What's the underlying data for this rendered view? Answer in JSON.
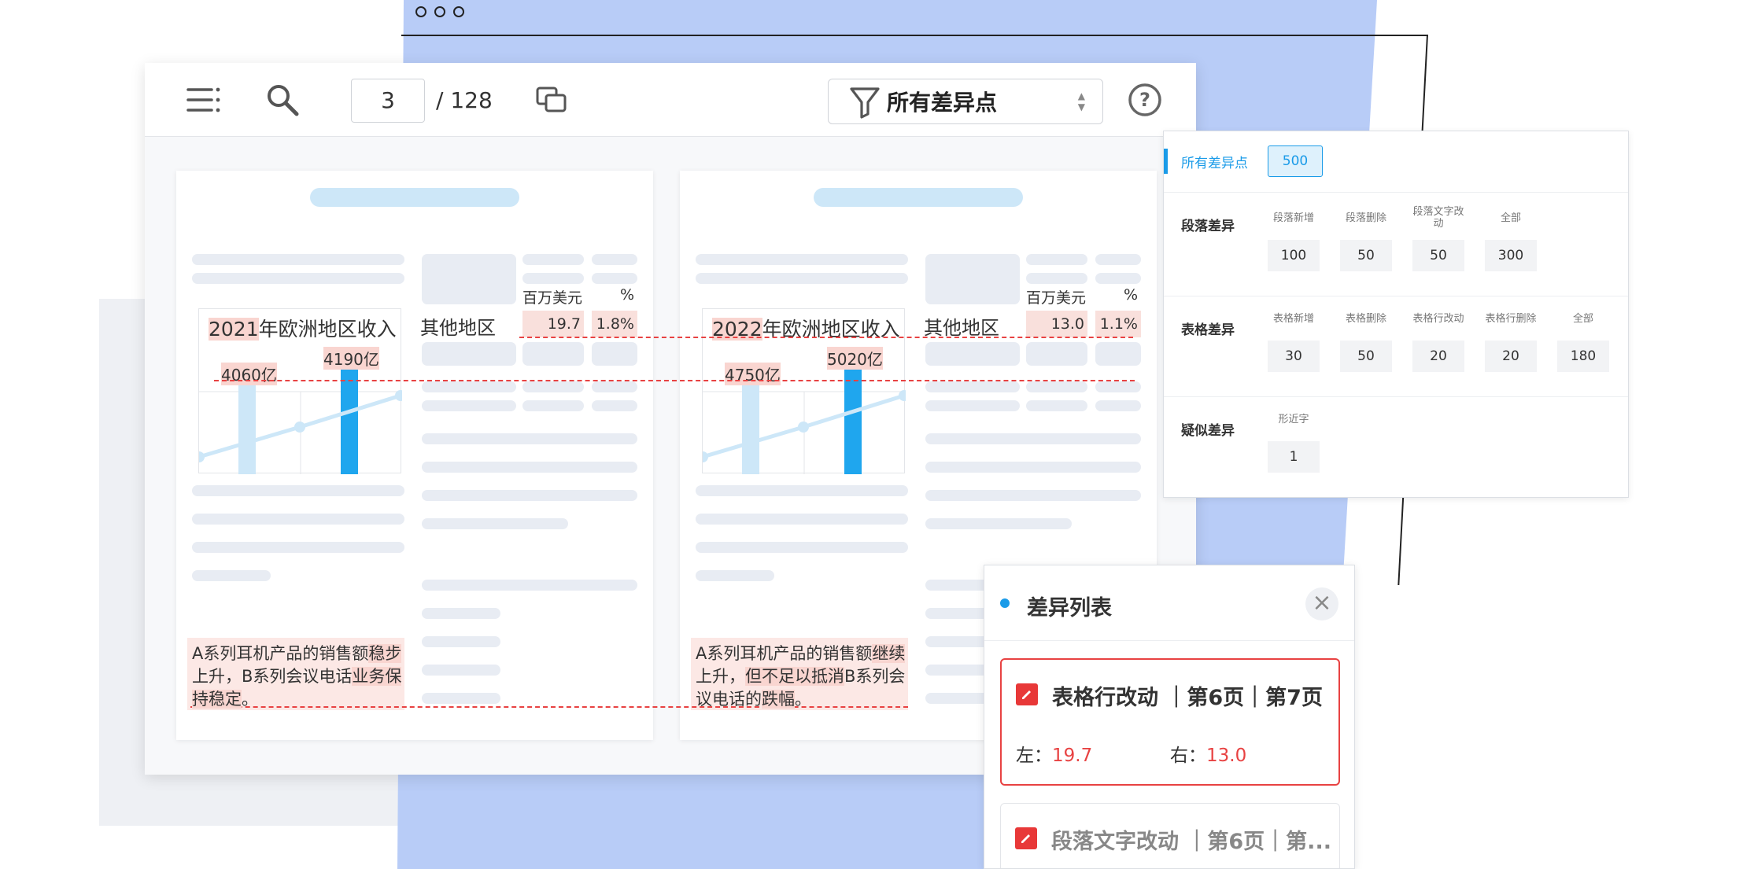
{
  "window": {
    "dots": [
      "o",
      "o",
      "o"
    ]
  },
  "toolbar": {
    "page_current": "3",
    "page_total": "/ 128",
    "filter_label": "所有差异点",
    "icons": [
      "menu-icon",
      "search-icon",
      "copy-icon",
      "filter-icon",
      "sort-icon",
      "help-icon"
    ]
  },
  "left_doc": {
    "chart_title_hl": "2021",
    "chart_title_rest": "年欧洲地区收入",
    "bar1_label": "4060亿",
    "bar2_label": "4190亿",
    "region": "其他地区",
    "col1_header": "百万美元",
    "col2_header": "%",
    "value1": "19.7",
    "value2": "1.8%",
    "para": [
      "A系列耳机产品的销售额",
      "稳步",
      "上升，B系列会议电话",
      "业务保持稳定",
      "。"
    ]
  },
  "right_doc": {
    "chart_title_hl": "2022",
    "chart_title_rest": "年欧洲地区收入",
    "bar1_label": "4750亿",
    "bar2_label": "5020亿",
    "region": "其他地区",
    "col1_header": "百万美元",
    "col2_header": "%",
    "value1": "13.0",
    "value2": "1.1%",
    "para": [
      "A系列耳机产品的销售额",
      "继续",
      "上升，",
      "但不足以抵消",
      "B系列会议电话的",
      "跌幅",
      "。"
    ]
  },
  "diff_panel": {
    "all": {
      "label": "所有差异点",
      "count": "500"
    },
    "paragraph": {
      "title": "段落差异",
      "items": [
        {
          "label": "段落新增",
          "count": "100"
        },
        {
          "label": "段落删除",
          "count": "50"
        },
        {
          "label": "段落文字改动",
          "count": "50"
        },
        {
          "label": "全部",
          "count": "300"
        }
      ]
    },
    "table": {
      "title": "表格差异",
      "items": [
        {
          "label": "表格新增",
          "count": "30"
        },
        {
          "label": "表格删除",
          "count": "50"
        },
        {
          "label": "表格行改动",
          "count": "20"
        },
        {
          "label": "表格行删除",
          "count": "20"
        },
        {
          "label": "全部",
          "count": "180"
        }
      ]
    },
    "similar": {
      "title": "疑似差异",
      "items": [
        {
          "label": "形近字",
          "count": "1"
        }
      ]
    }
  },
  "diff_list": {
    "title": "差异列表",
    "close": "×",
    "cards": [
      {
        "title": "表格行改动 ｜第6页｜第7页",
        "left_key": "左：",
        "left_val": "19.7",
        "right_key": "右：",
        "right_val": "13.0"
      },
      {
        "title": "段落文字改动 ｜第6页｜第..."
      }
    ]
  },
  "colors": {
    "accent": "#1a9be8",
    "diff_red": "#e84242",
    "highlight": "#f9d5d0",
    "bar_light": "#cde7f8",
    "bar_dark": "#1fa6ee"
  }
}
